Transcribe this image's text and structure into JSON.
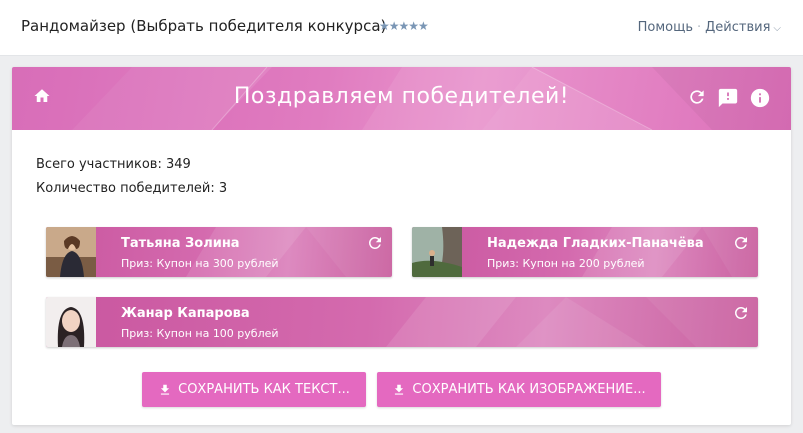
{
  "header": {
    "title": "Рандомайзер (Выбрать победителя конкурса)",
    "stars": "★★★★★",
    "help_label": "Помощь",
    "separator": "·",
    "actions_label": "Действия"
  },
  "banner": {
    "title": "Поздравляем победителей!"
  },
  "stats": {
    "participants": "Всего участников: 349",
    "winners_count": "Количество победителей: 3"
  },
  "winners": [
    {
      "name": "Татьяна Золина",
      "prize": "Приз: Купон на 300 рублей"
    },
    {
      "name": "Надежда Гладких-Паначёва",
      "prize": "Приз: Купон на 200 рублей"
    },
    {
      "name": "Жанар Капарова",
      "prize": "Приз: Купон на 100 рублей"
    }
  ],
  "buttons": {
    "save_text": "СОХРАНИТЬ КАК ТЕКСТ...",
    "save_image": "СОХРАНИТЬ КАК ИЗОБРАЖЕНИЕ..."
  },
  "icons": {
    "home": "home-icon",
    "refresh": "refresh-icon",
    "report": "report-icon",
    "info": "info-icon",
    "download": "download-icon"
  },
  "colors": {
    "banner": "#dc6fb9",
    "button": "#e469c0",
    "link": "#55677d",
    "stars": "#7a96b5"
  }
}
